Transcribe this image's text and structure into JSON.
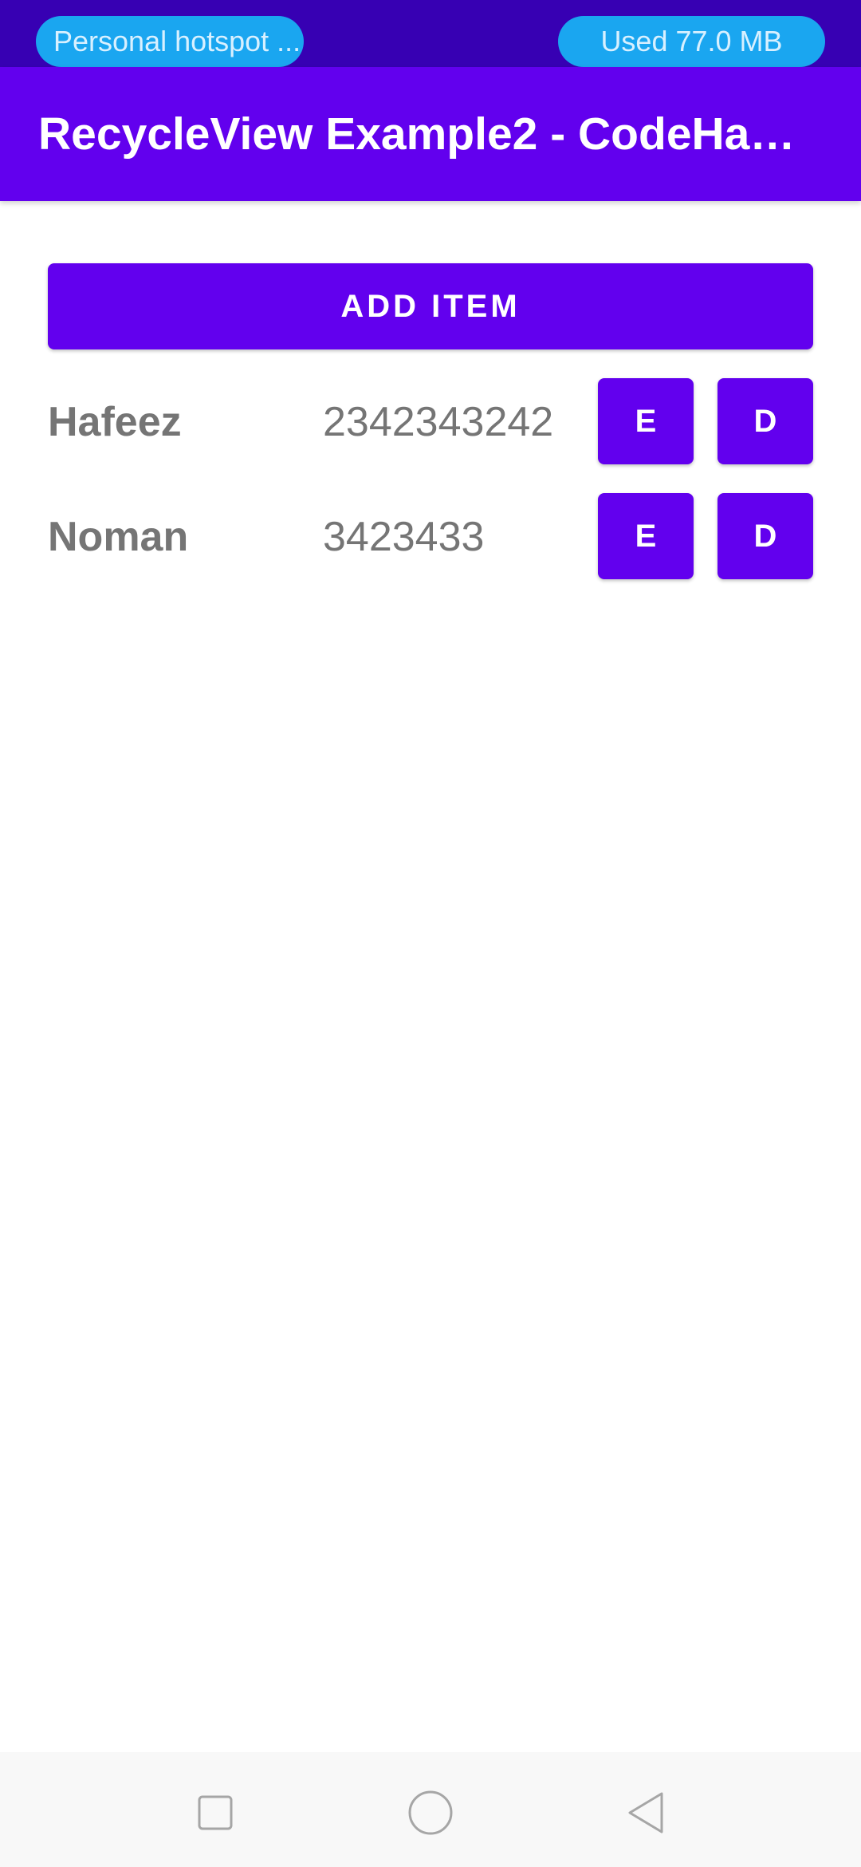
{
  "status_bar": {
    "hotspot_label": "Personal hotspot ...",
    "data_usage": "Used  77.0 MB"
  },
  "app_bar": {
    "title": "RecycleView Example2 - CodeHa…"
  },
  "add_button_label": "ADD ITEM",
  "items": [
    {
      "name": "Hafeez",
      "number": "2342343242",
      "edit_label": "E",
      "delete_label": "D"
    },
    {
      "name": "Noman",
      "number": "3423433",
      "edit_label": "E",
      "delete_label": "D"
    }
  ],
  "nav_bar": {
    "recent_icon": "square-recents-icon",
    "home_icon": "circle-home-icon",
    "back_icon": "triangle-back-icon"
  },
  "colors": {
    "status_bar": "#3700b3",
    "primary": "#6200ee",
    "pill": "#1aa6f0",
    "text_secondary": "#757575"
  }
}
